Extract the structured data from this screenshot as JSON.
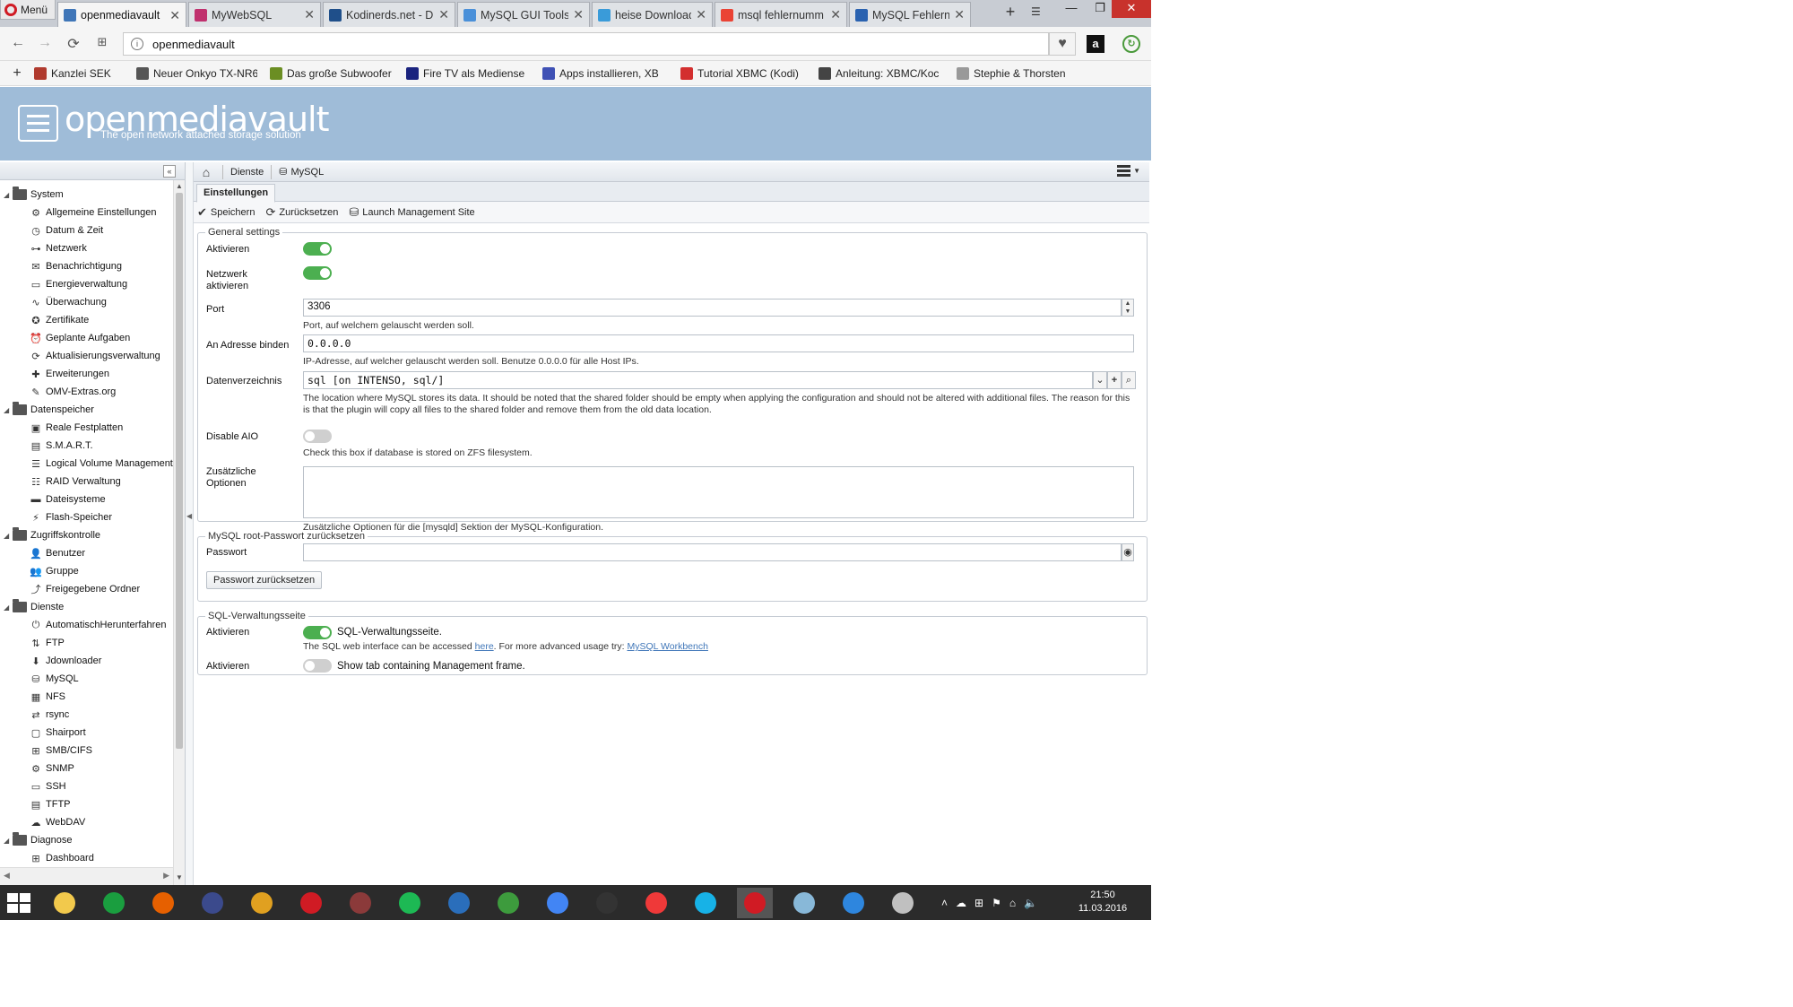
{
  "browser": {
    "menu_label": "Menü",
    "tabs": [
      {
        "title": "openmediavault",
        "color": "#3f76b8",
        "active": true
      },
      {
        "title": "MyWebSQL",
        "color": "#c0306e",
        "active": false
      },
      {
        "title": "Kodinerds.net - Di",
        "color": "#1f4f8a",
        "active": false
      },
      {
        "title": "MySQL GUI Tools",
        "color": "#4a90d9",
        "active": false
      },
      {
        "title": "heise Download",
        "color": "#3a9bd9",
        "active": false
      },
      {
        "title": "msql fehlernumm",
        "color": "#ea4335",
        "active": false
      },
      {
        "title": "MySQL Fehlernum",
        "color": "#2a62b0",
        "active": false
      }
    ],
    "new_tab_glyph": "+",
    "url": "openmediavault",
    "bookmarks": [
      {
        "label": "Kanzlei SEK",
        "color": "#b03a2e"
      },
      {
        "label": "Neuer Onkyo TX-NR6",
        "color": "#555555"
      },
      {
        "label": "Das große Subwoofer",
        "color": "#6b8e23"
      },
      {
        "label": "Fire TV als Mediense",
        "color": "#1a237e"
      },
      {
        "label": "Apps installieren, XB",
        "color": "#3f51b5"
      },
      {
        "label": "Tutorial XBMC (Kodi)",
        "color": "#d32f2f"
      },
      {
        "label": "Anleitung: XBMC/Koc",
        "color": "#444444"
      },
      {
        "label": "Stephie & Thorsten",
        "color": "#999999"
      }
    ]
  },
  "app": {
    "title": "openmediavault",
    "subtitle": "The open network attached storage solution"
  },
  "sidebar": {
    "categories": [
      {
        "label": "System",
        "items": [
          {
            "label": "Allgemeine Einstellungen",
            "icon": "⚙"
          },
          {
            "label": "Datum & Zeit",
            "icon": "◷"
          },
          {
            "label": "Netzwerk",
            "icon": "⊶"
          },
          {
            "label": "Benachrichtigung",
            "icon": "✉"
          },
          {
            "label": "Energieverwaltung",
            "icon": "▭"
          },
          {
            "label": "Überwachung",
            "icon": "∿"
          },
          {
            "label": "Zertifikate",
            "icon": "✪"
          },
          {
            "label": "Geplante Aufgaben",
            "icon": "⏰"
          },
          {
            "label": "Aktualisierungsverwaltung",
            "icon": "⟳"
          },
          {
            "label": "Erweiterungen",
            "icon": "✚"
          },
          {
            "label": "OMV-Extras.org",
            "icon": "✎"
          }
        ]
      },
      {
        "label": "Datenspeicher",
        "items": [
          {
            "label": "Reale Festplatten",
            "icon": "▣"
          },
          {
            "label": "S.M.A.R.T.",
            "icon": "▤"
          },
          {
            "label": "Logical Volume Management",
            "icon": "☰"
          },
          {
            "label": "RAID Verwaltung",
            "icon": "☷"
          },
          {
            "label": "Dateisysteme",
            "icon": "▬"
          },
          {
            "label": "Flash-Speicher",
            "icon": "⚡"
          }
        ]
      },
      {
        "label": "Zugriffskontrolle",
        "items": [
          {
            "label": "Benutzer",
            "icon": "👤"
          },
          {
            "label": "Gruppe",
            "icon": "👥"
          },
          {
            "label": "Freigegebene Ordner",
            "icon": "⤴"
          }
        ]
      },
      {
        "label": "Dienste",
        "items": [
          {
            "label": "AutomatischHerunterfahren",
            "icon": "⏻"
          },
          {
            "label": "FTP",
            "icon": "⇅"
          },
          {
            "label": "Jdownloader",
            "icon": "⬇"
          },
          {
            "label": "MySQL",
            "icon": "⛁"
          },
          {
            "label": "NFS",
            "icon": "▦"
          },
          {
            "label": "rsync",
            "icon": "⇄"
          },
          {
            "label": "Shairport",
            "icon": "▢"
          },
          {
            "label": "SMB/CIFS",
            "icon": "⊞"
          },
          {
            "label": "SNMP",
            "icon": "⚙"
          },
          {
            "label": "SSH",
            "icon": "▭"
          },
          {
            "label": "TFTP",
            "icon": "▤"
          },
          {
            "label": "WebDAV",
            "icon": "☁"
          }
        ]
      },
      {
        "label": "Diagnose",
        "items": [
          {
            "label": "Dashboard",
            "icon": "⊞"
          }
        ]
      }
    ]
  },
  "breadcrumb": {
    "items": [
      "Dienste",
      "MySQL"
    ]
  },
  "tabs": {
    "settings": "Einstellungen"
  },
  "toolbar": {
    "save": "Speichern",
    "reset": "Zurücksetzen",
    "launch": "Launch Management Site"
  },
  "general": {
    "legend": "General settings",
    "enable_label": "Aktivieren",
    "enable_on": true,
    "network_label": "Netzwerk aktivieren",
    "network_on": true,
    "port_label": "Port",
    "port_value": "3306",
    "port_hint": "Port, auf welchem gelauscht werden soll.",
    "bind_label": "An Adresse binden",
    "bind_value": "0.0.0.0",
    "bind_hint": "IP-Adresse, auf welcher gelauscht werden soll. Benutze 0.0.0.0 für alle Host IPs.",
    "datadir_label": "Datenverzeichnis",
    "datadir_value": "sql [on INTENSO, sql/]",
    "datadir_hint": "The location where MySQL stores its data. It should be noted that the shared folder should be empty when applying the configuration and should not be altered with additional files. The reason for this is that the plugin will copy all files to the shared folder and remove them from the old data location.",
    "aio_label": "Disable AIO",
    "aio_on": false,
    "aio_hint": "Check this box if database is stored on ZFS filesystem.",
    "extra_label": "Zusätzliche Optionen",
    "extra_value": "",
    "extra_hint": "Zusätzliche Optionen für die [mysqld] Sektion der MySQL-Konfiguration."
  },
  "root_pw": {
    "legend": "MySQL root-Passwort zurücksetzen",
    "password_label": "Passwort",
    "password_value": "",
    "reset_button": "Passwort zurücksetzen"
  },
  "mgmt": {
    "legend": "SQL-Verwaltungsseite",
    "enable_label": "Aktivieren",
    "enable_on": true,
    "enable_text": "SQL-Verwaltungsseite.",
    "hint_prefix": "The SQL web interface can be accessed ",
    "hint_link1": "here",
    "hint_middle": ". For more advanced usage try: ",
    "hint_link2": "MySQL Workbench",
    "tab_label": "Aktivieren",
    "tab_on": false,
    "tab_text": "Show tab containing Management frame."
  },
  "taskbar": {
    "apps": [
      {
        "name": "file-explorer",
        "color": "#f2c94c"
      },
      {
        "name": "store",
        "color": "#1a9e3f"
      },
      {
        "name": "firefox",
        "color": "#e66000"
      },
      {
        "name": "keepass",
        "color": "#3b4a8c"
      },
      {
        "name": "euro-app",
        "color": "#e0a020"
      },
      {
        "name": "opera",
        "color": "#d01b24"
      },
      {
        "name": "media-app",
        "color": "#8b3a3a"
      },
      {
        "name": "spotify",
        "color": "#1db954"
      },
      {
        "name": "outlook",
        "color": "#2a6ebb"
      },
      {
        "name": "globe-app",
        "color": "#3d9b3d"
      },
      {
        "name": "chrome",
        "color": "#4285f4"
      },
      {
        "name": "camera-app",
        "color": "#333333"
      },
      {
        "name": "vivaldi",
        "color": "#ef3939"
      },
      {
        "name": "kodi",
        "color": "#17b2e7"
      },
      {
        "name": "opera-active",
        "color": "#d01b24"
      },
      {
        "name": "notes-app",
        "color": "#88b8d8"
      },
      {
        "name": "player-app",
        "color": "#2e86de"
      },
      {
        "name": "paint-app",
        "color": "#c0c0c0"
      }
    ],
    "time": "21:50",
    "date": "11.03.2016"
  }
}
